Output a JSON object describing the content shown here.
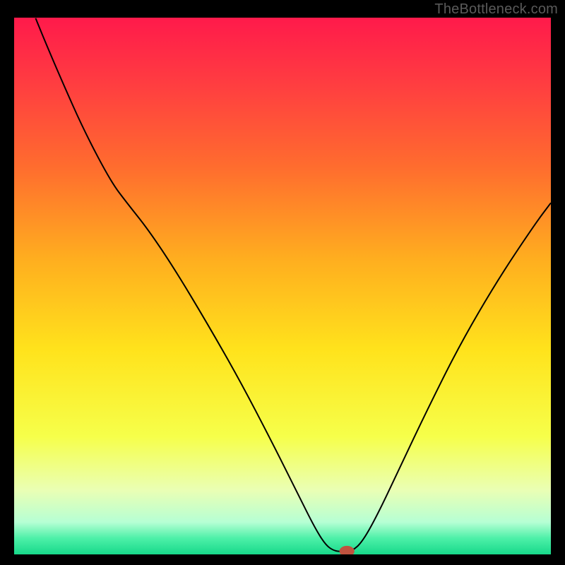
{
  "watermark": "TheBottleneck.com",
  "chart_data": {
    "type": "line",
    "title": "",
    "xlabel": "",
    "ylabel": "",
    "xlim": [
      0,
      100
    ],
    "ylim": [
      0,
      100
    ],
    "background_gradient": {
      "stops": [
        {
          "offset": 0.0,
          "color": "#ff1a4b"
        },
        {
          "offset": 0.12,
          "color": "#ff3c41"
        },
        {
          "offset": 0.28,
          "color": "#ff6d2e"
        },
        {
          "offset": 0.45,
          "color": "#ffae1f"
        },
        {
          "offset": 0.62,
          "color": "#ffe31c"
        },
        {
          "offset": 0.78,
          "color": "#f6ff4a"
        },
        {
          "offset": 0.88,
          "color": "#eaffb4"
        },
        {
          "offset": 0.94,
          "color": "#b6ffd4"
        },
        {
          "offset": 0.97,
          "color": "#4df0a8"
        },
        {
          "offset": 1.0,
          "color": "#17d98a"
        }
      ]
    },
    "series": [
      {
        "name": "bottleneck-curve",
        "color": "#000000",
        "width": 2,
        "points": [
          {
            "x": 4.0,
            "y": 99.9
          },
          {
            "x": 6.0,
            "y": 95.0
          },
          {
            "x": 9.0,
            "y": 88.0
          },
          {
            "x": 13.0,
            "y": 79.0
          },
          {
            "x": 18.0,
            "y": 69.5
          },
          {
            "x": 21.0,
            "y": 65.5
          },
          {
            "x": 25.0,
            "y": 60.5
          },
          {
            "x": 30.0,
            "y": 53.0
          },
          {
            "x": 36.0,
            "y": 43.0
          },
          {
            "x": 42.0,
            "y": 32.5
          },
          {
            "x": 48.0,
            "y": 21.0
          },
          {
            "x": 53.0,
            "y": 11.0
          },
          {
            "x": 56.0,
            "y": 5.0
          },
          {
            "x": 58.0,
            "y": 1.8
          },
          {
            "x": 59.5,
            "y": 0.7
          },
          {
            "x": 61.0,
            "y": 0.5
          },
          {
            "x": 63.0,
            "y": 0.6
          },
          {
            "x": 65.0,
            "y": 2.5
          },
          {
            "x": 68.0,
            "y": 8.0
          },
          {
            "x": 72.0,
            "y": 16.5
          },
          {
            "x": 77.0,
            "y": 27.0
          },
          {
            "x": 83.0,
            "y": 39.0
          },
          {
            "x": 90.0,
            "y": 51.0
          },
          {
            "x": 97.0,
            "y": 61.5
          },
          {
            "x": 100.0,
            "y": 65.5
          }
        ]
      }
    ],
    "marker": {
      "name": "optimal-point",
      "x": 62.0,
      "y": 0.6,
      "rx": 1.4,
      "ry": 1.0,
      "fill": "#c0533f"
    }
  }
}
